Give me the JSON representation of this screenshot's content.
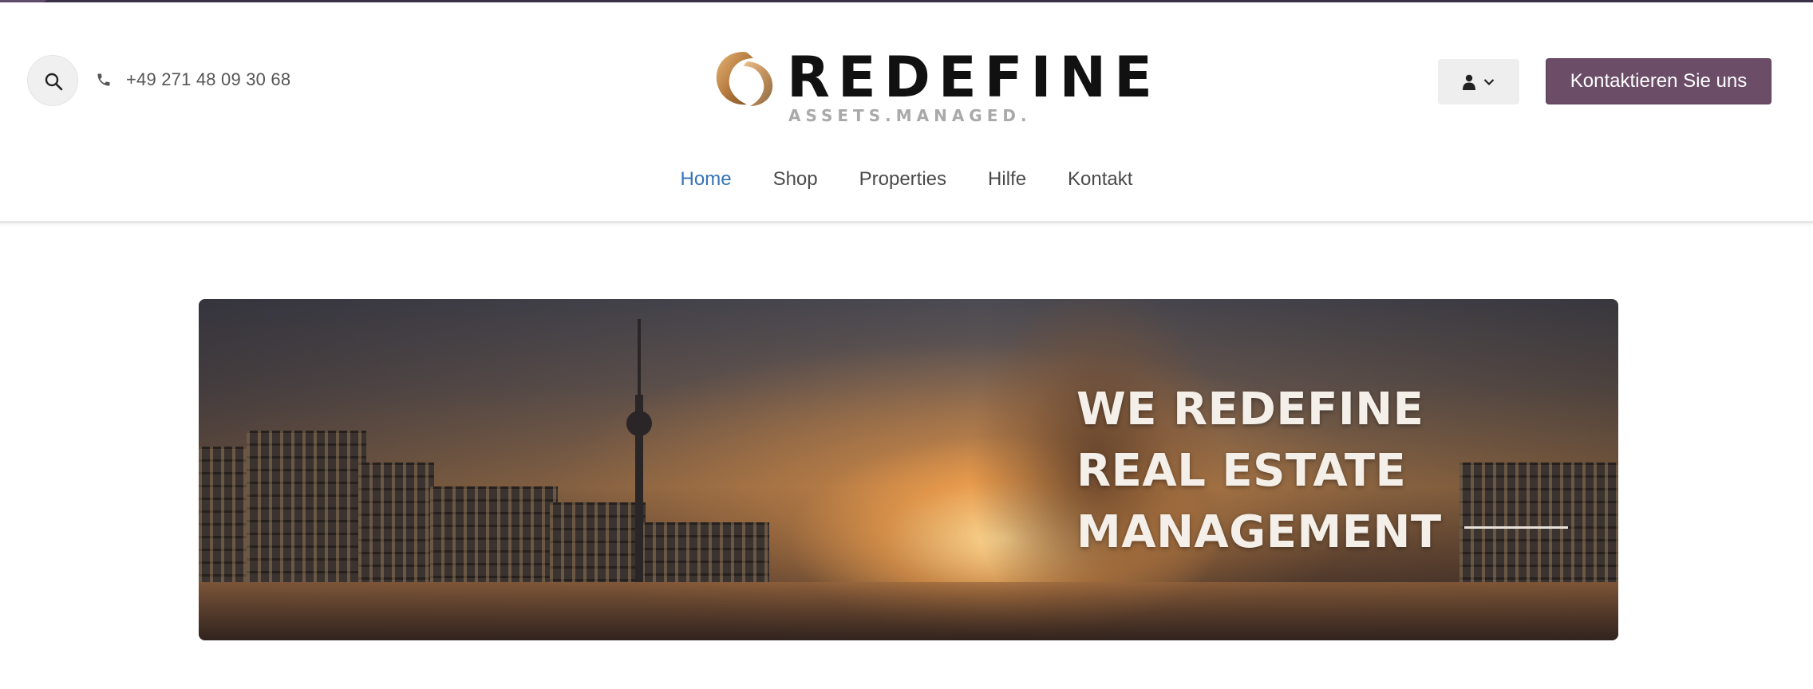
{
  "header": {
    "phone": "+49 271 48 09 30 68",
    "logo": {
      "wordmark": "REDEFINE",
      "tagline": "ASSETS.MANAGED."
    },
    "cta_label": "Kontaktieren Sie uns",
    "accent_color": "#6b4d68"
  },
  "icons": {
    "search": "search-icon",
    "phone": "phone-icon",
    "user": "user-icon",
    "chevron": "chevron-down-icon"
  },
  "nav": {
    "items": [
      {
        "label": "Home",
        "active": true
      },
      {
        "label": "Shop"
      },
      {
        "label": "Properties"
      },
      {
        "label": "Hilfe"
      },
      {
        "label": "Kontakt"
      }
    ],
    "active_color": "#3673b8"
  },
  "hero": {
    "line1": "WE REDEFINE",
    "line2": "REAL ESTATE",
    "line3": "MANAGEMENT"
  }
}
